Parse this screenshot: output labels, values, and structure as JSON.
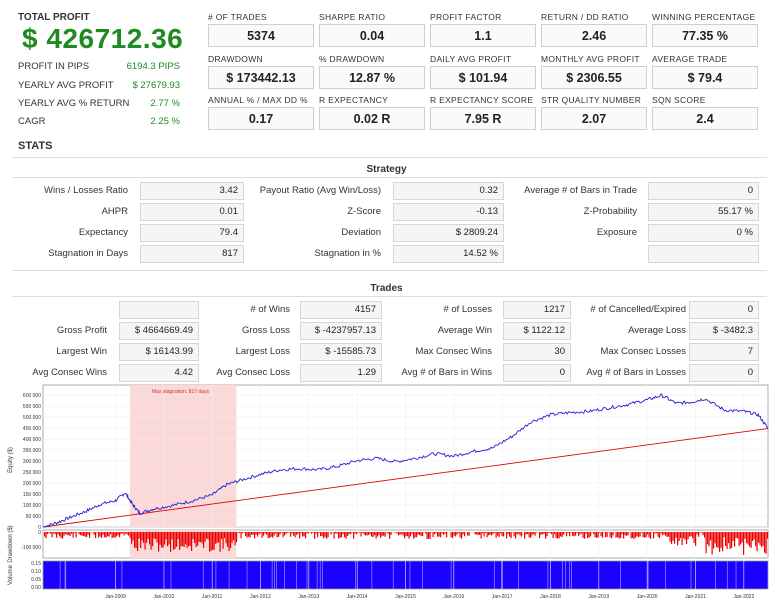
{
  "summary": {
    "total_label": "TOTAL PROFIT",
    "total_value": "$ 426712.36",
    "rows": [
      {
        "label": "PROFIT IN PIPS",
        "value": "6194.3 PIPS"
      },
      {
        "label": "YEARLY AVG PROFIT",
        "value": "$ 27679.93"
      },
      {
        "label": "YEARLY AVG % RETURN",
        "value": "2.77 %"
      },
      {
        "label": "CAGR",
        "value": "2.25 %"
      }
    ]
  },
  "metrics": [
    {
      "label": "# OF TRADES",
      "value": "5374"
    },
    {
      "label": "SHARPE RATIO",
      "value": "0.04"
    },
    {
      "label": "PROFIT FACTOR",
      "value": "1.1"
    },
    {
      "label": "RETURN / DD RATIO",
      "value": "2.46"
    },
    {
      "label": "WINNING PERCENTAGE",
      "value": "77.35 %"
    },
    {
      "label": "DRAWDOWN",
      "value": "$ 173442.13"
    },
    {
      "label": "% DRAWDOWN",
      "value": "12.87 %"
    },
    {
      "label": "DAILY AVG PROFIT",
      "value": "$ 101.94"
    },
    {
      "label": "MONTHLY AVG PROFIT",
      "value": "$ 2306.55"
    },
    {
      "label": "AVERAGE TRADE",
      "value": "$ 79.4"
    },
    {
      "label": "ANNUAL % / MAX DD %",
      "value": "0.17"
    },
    {
      "label": "R EXPECTANCY",
      "value": "0.02 R"
    },
    {
      "label": "R EXPECTANCY SCORE",
      "value": "7.95 R"
    },
    {
      "label": "STR QUALITY NUMBER",
      "value": "2.07"
    },
    {
      "label": "SQN SCORE",
      "value": "2.4"
    }
  ],
  "stats_title": "STATS",
  "strategy": {
    "title": "Strategy",
    "rows": [
      [
        {
          "label": "Wins / Losses Ratio",
          "value": "3.42"
        },
        {
          "label": "Payout Ratio (Avg Win/Loss)",
          "value": "0.32"
        },
        {
          "label": "Average # of Bars in Trade",
          "value": "0"
        }
      ],
      [
        {
          "label": "AHPR",
          "value": "0.01"
        },
        {
          "label": "Z-Score",
          "value": "-0.13"
        },
        {
          "label": "Z-Probability",
          "value": "55.17 %"
        }
      ],
      [
        {
          "label": "Expectancy",
          "value": "79.4"
        },
        {
          "label": "Deviation",
          "value": "$ 2809.24"
        },
        {
          "label": "Exposure",
          "value": "0 %"
        }
      ],
      [
        {
          "label": "Stagnation in Days",
          "value": "817"
        },
        {
          "label": "Stagnation in %",
          "value": "14.52 %"
        },
        {
          "label": "",
          "value": ""
        }
      ]
    ]
  },
  "trades": {
    "title": "Trades",
    "rows": [
      [
        {
          "label": "",
          "value": ""
        },
        {
          "label": "# of Wins",
          "value": "4157"
        },
        {
          "label": "# of Losses",
          "value": "1217"
        },
        {
          "label": "# of Cancelled/Expired",
          "value": "0"
        }
      ],
      [
        {
          "label": "Gross Profit",
          "value": "$ 4664669.49"
        },
        {
          "label": "Gross Loss",
          "value": "$ -4237957.13"
        },
        {
          "label": "Average Win",
          "value": "$ 1122.12"
        },
        {
          "label": "Average Loss",
          "value": "$ -3482.3"
        }
      ],
      [
        {
          "label": "Largest Win",
          "value": "$ 16143.99"
        },
        {
          "label": "Largest Loss",
          "value": "$ -15585.73"
        },
        {
          "label": "Max Consec Wins",
          "value": "30"
        },
        {
          "label": "Max Consec Losses",
          "value": "7"
        }
      ],
      [
        {
          "label": "Avg Consec Wins",
          "value": "4.42"
        },
        {
          "label": "Avg Consec Loss",
          "value": "1.29"
        },
        {
          "label": "Avg # of Bars in Wins",
          "value": "0"
        },
        {
          "label": "Avg # of Bars in Losses",
          "value": "0"
        }
      ]
    ]
  },
  "chart_data": {
    "type": "line",
    "annotation": "Max stagnation: 817 days",
    "equity_axis_label": "Equity ($)",
    "drawdown_axis_label": "Drawdown ($)",
    "volume_axis_label": "Volume",
    "equity_yticks": [
      "0",
      "50 000",
      "100 000",
      "150 000",
      "200 000",
      "250 000",
      "300 000",
      "350 000",
      "400 000",
      "450 000",
      "500 000",
      "550 000",
      "600 000"
    ],
    "drawdown_yticks": [
      "0",
      "-100 000"
    ],
    "volume_yticks": [
      "0.15",
      "0.10",
      "0.05",
      "0.00"
    ],
    "x_ticks": [
      "Jan-2009",
      "Jan-2010",
      "Jan-2011",
      "Jan-2012",
      "Jan-2013",
      "Jan-2014",
      "Jan-2015",
      "Jan-2016",
      "Jan-2017",
      "Jan-2018",
      "Jan-2019",
      "Jan-2020",
      "Jan-2021",
      "Jan-2022"
    ],
    "x_range": [
      2007.5,
      2022.5
    ],
    "equity_ylim": [
      0,
      620000
    ],
    "stagnation_range": [
      2009.3,
      2011.5
    ],
    "equity_series": {
      "x": [
        2007.5,
        2007.8,
        2008.1,
        2008.4,
        2008.7,
        2009.0,
        2009.2,
        2009.35,
        2009.5,
        2009.8,
        2010.2,
        2010.6,
        2011.0,
        2011.3,
        2011.6,
        2012.0,
        2012.4,
        2012.8,
        2013.2,
        2013.6,
        2014.0,
        2014.4,
        2014.8,
        2015.2,
        2015.6,
        2016.0,
        2016.4,
        2016.8,
        2017.2,
        2017.6,
        2018.0,
        2018.4,
        2018.8,
        2019.2,
        2019.6,
        2020.0,
        2020.3,
        2020.6,
        2020.9,
        2021.2,
        2021.6,
        2022.0,
        2022.3,
        2022.5
      ],
      "y": [
        0,
        20000,
        45000,
        70000,
        100000,
        115000,
        150000,
        100000,
        60000,
        80000,
        95000,
        115000,
        140000,
        185000,
        205000,
        230000,
        250000,
        255000,
        250000,
        265000,
        290000,
        300000,
        285000,
        300000,
        320000,
        310000,
        330000,
        345000,
        395000,
        460000,
        490000,
        500000,
        505000,
        520000,
        535000,
        555000,
        575000,
        540000,
        545000,
        560000,
        510000,
        505000,
        490000,
        430000
      ]
    },
    "trend_series": {
      "x": [
        2007.5,
        2022.5
      ],
      "y": [
        0,
        430000
      ]
    }
  }
}
